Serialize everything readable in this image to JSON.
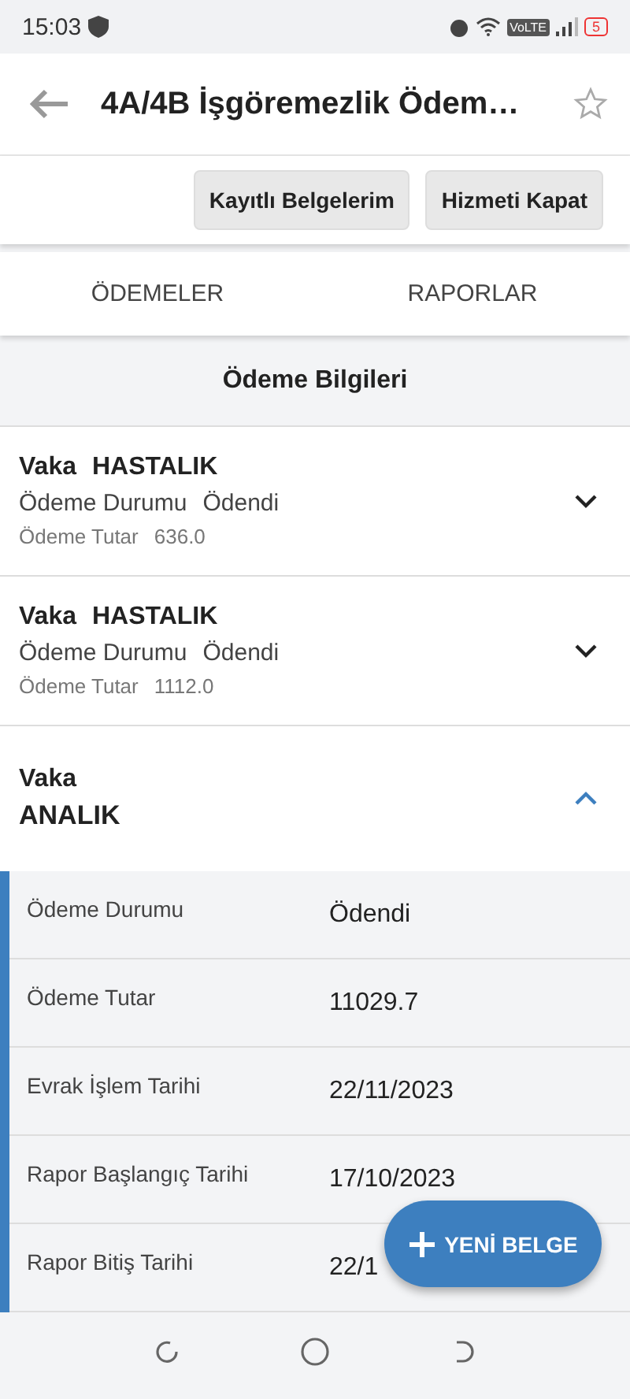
{
  "status_bar": {
    "time": "15:03",
    "network_label": "VoLTE",
    "battery": "5"
  },
  "app_bar": {
    "title": "4A/4B İşgöremezlik Ödem…"
  },
  "actions": [
    "Kayıtlı Belgelerim",
    "Hizmeti Kapat"
  ],
  "tabs": [
    {
      "label": "ÖDEMELER"
    },
    {
      "label": "RAPORLAR"
    }
  ],
  "section_title": "Ödeme Bilgileri",
  "payments": [
    {
      "case_label": "Vaka",
      "case_value": "HASTALIK",
      "status_label": "Ödeme Durumu",
      "status_value": "Ödendi",
      "amount_label": "Ödeme Tutar",
      "amount_value": "636.0",
      "expanded": false
    },
    {
      "case_label": "Vaka",
      "case_value": "HASTALIK",
      "status_label": "Ödeme Durumu",
      "status_value": "Ödendi",
      "amount_label": "Ödeme Tutar",
      "amount_value": "1112.0",
      "expanded": false
    },
    {
      "case_label": "Vaka",
      "case_value": "ANALIK",
      "expanded": true,
      "details": [
        {
          "label": "Ödeme Durumu",
          "value": "Ödendi"
        },
        {
          "label": "Ödeme Tutar",
          "value": "11029.7"
        },
        {
          "label": "Evrak İşlem Tarihi",
          "value": "22/11/2023"
        },
        {
          "label": "Rapor Başlangıç Tarihi",
          "value": "17/10/2023"
        },
        {
          "label": "Rapor Bitiş Tarihi",
          "value": "22/1"
        }
      ]
    }
  ],
  "fab": {
    "label": "YENİ BELGE"
  }
}
